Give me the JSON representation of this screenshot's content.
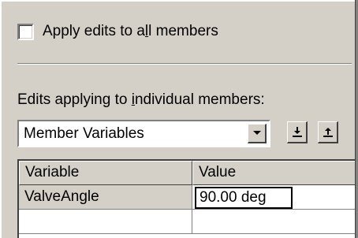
{
  "apply_all": {
    "label_before": "Apply edits to a",
    "label_mnemonic": "l",
    "label_after": "l members",
    "checked": false
  },
  "individual": {
    "label_before": "Edits applying to ",
    "label_mnemonic": "i",
    "label_after": "ndividual members:"
  },
  "combo": {
    "selected": "Member Variables",
    "icon": "chevron-down-icon"
  },
  "toolbar": {
    "import_icon": "import-icon",
    "export_icon": "export-icon"
  },
  "grid": {
    "columns": [
      "Variable",
      "Value"
    ],
    "rows": [
      {
        "variable": "ValveAngle",
        "value": "90.00 deg"
      },
      {
        "variable": "",
        "value": ""
      }
    ]
  }
}
